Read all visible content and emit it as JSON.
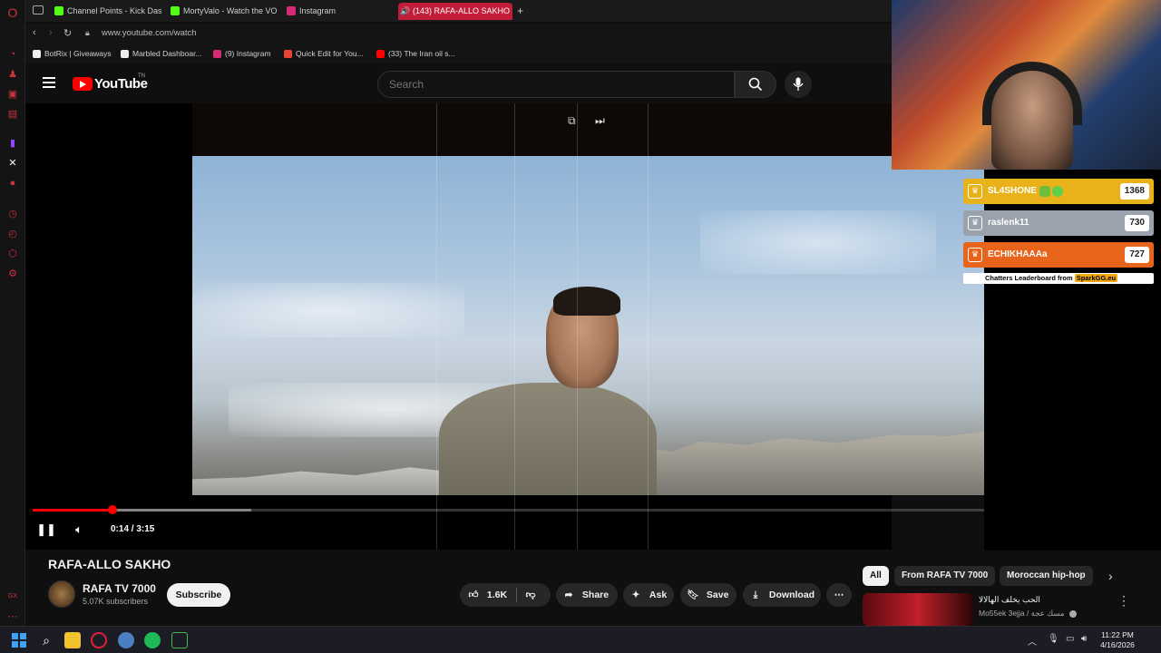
{
  "browser": {
    "tabs": [
      {
        "label": "Channel Points - Kick Das",
        "color": "#53fc18"
      },
      {
        "label": "MortyValo - Watch the VO",
        "color": "#53fc18"
      },
      {
        "label": "Instagram",
        "color": "#d62976"
      },
      {
        "label": "(143) RAFA-ALLO SAKHO",
        "color": "#ffffff"
      }
    ],
    "new_tab": "+",
    "url": "www.youtube.com/watch",
    "bookmarks": [
      {
        "label": "BotRix | Giveaways",
        "color": "#ffffff"
      },
      {
        "label": "Marbled Dashboar...",
        "color": "#ffffff"
      },
      {
        "label": "(9) Instagram",
        "color": "#d62976"
      },
      {
        "label": "Quick Edit for You...",
        "color": "#ea4335"
      },
      {
        "label": "(33) The Iran oil s...",
        "color": "#ff0000"
      }
    ]
  },
  "youtube": {
    "logo_text": "YouTube",
    "logo_tm": "TN",
    "search_placeholder": "Search"
  },
  "player": {
    "time": "0:14 / 3:15",
    "progress_fraction": 0.072,
    "buffered_fraction": 0.197
  },
  "video": {
    "title": "RAFA-ALLO SAKHO",
    "channel": "RAFA TV 7000",
    "subscribers": "5.07K subscribers",
    "subscribe_label": "Subscribe",
    "likes": "1.6K",
    "share_label": "Share",
    "ask_label": "Ask",
    "save_label": "Save",
    "download_label": "Download"
  },
  "chips": [
    "All",
    "From RAFA TV 7000",
    "Moroccan hip-hop"
  ],
  "recommendation": {
    "title": "الحب يخلف الهالالا",
    "channel": "Mo55ek 3ejja / مسك عجة"
  },
  "leaderboard": {
    "rows": [
      {
        "name": "SL4SHONE",
        "count": "1368",
        "color": "#e9b21a"
      },
      {
        "name": "raslenk11",
        "count": "730",
        "color": "#9aa3ad"
      },
      {
        "name": "ECHIKHAAAa",
        "count": "727",
        "color": "#e8641a"
      }
    ],
    "footer": "Chatters Leaderboard from",
    "brand": "SparkGG.eu"
  },
  "taskbar": {
    "time": "11:22 PM",
    "date": "4/16/2026"
  }
}
